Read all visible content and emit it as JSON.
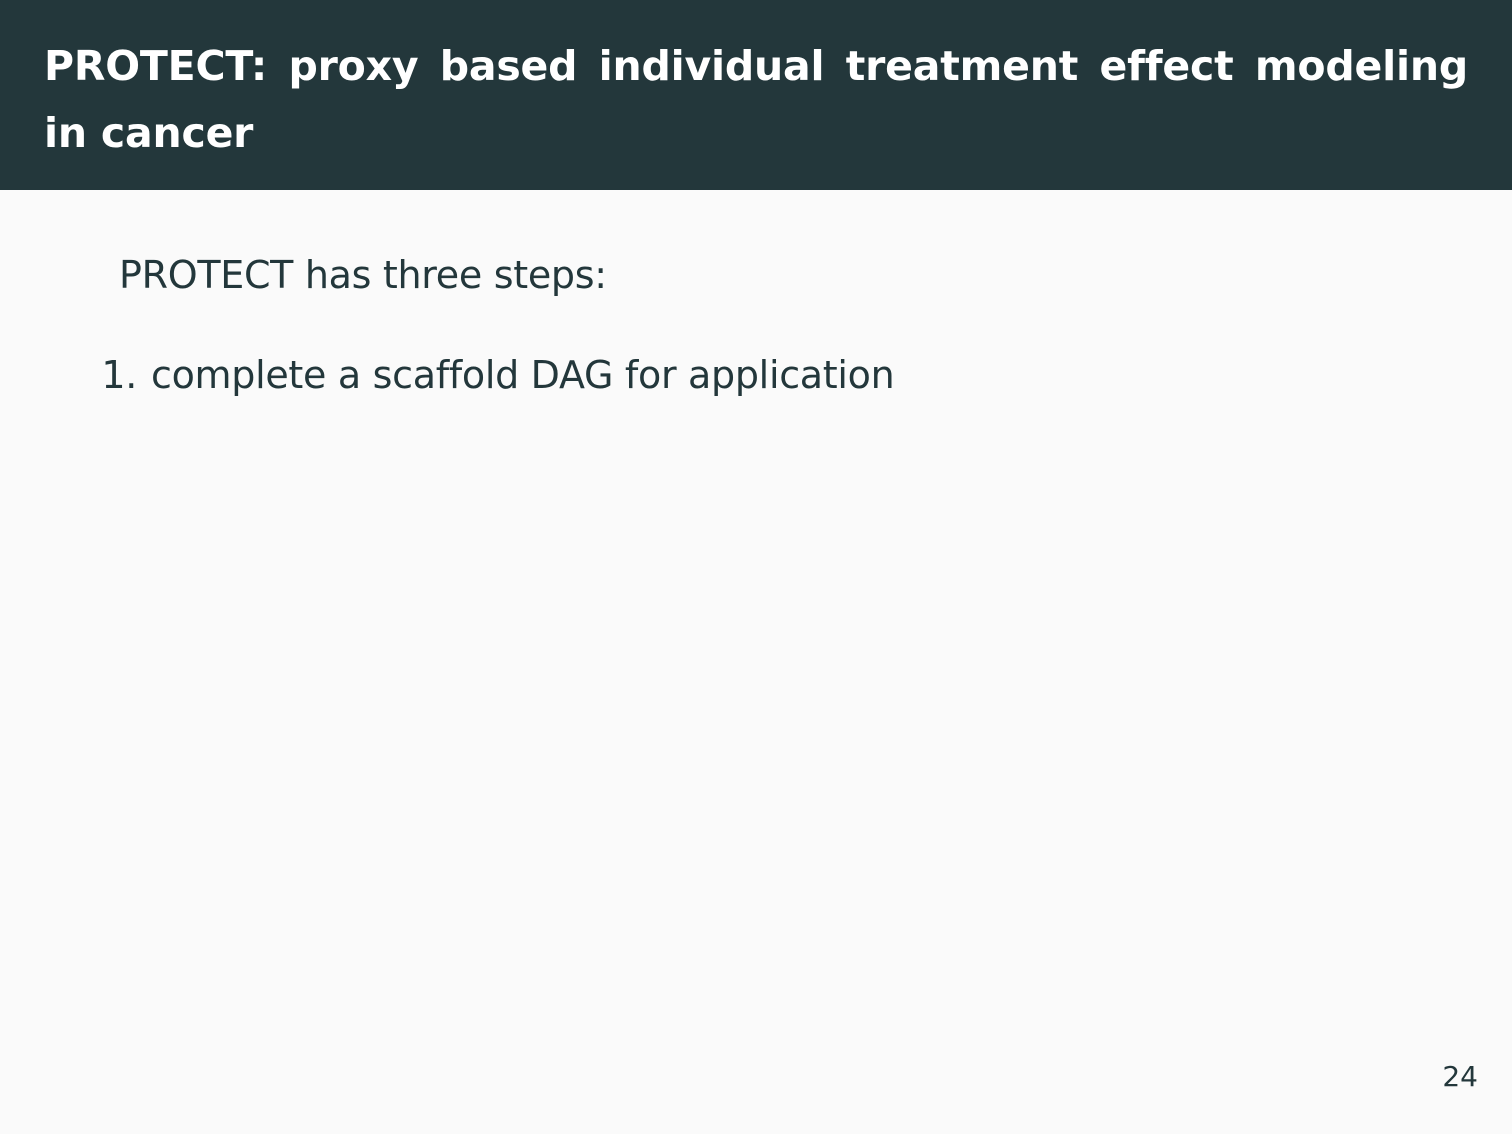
{
  "header": {
    "title": "PROTECT: proxy based individual treatment effect modeling in cancer"
  },
  "body": {
    "intro": "PROTECT has three steps:",
    "steps": [
      {
        "number": "1.",
        "text": "complete a scaffold DAG for application"
      }
    ]
  },
  "footer": {
    "page_number": "24"
  },
  "colors": {
    "header_background": "#23373b",
    "page_background": "#fafafa",
    "text": "#23373b"
  }
}
